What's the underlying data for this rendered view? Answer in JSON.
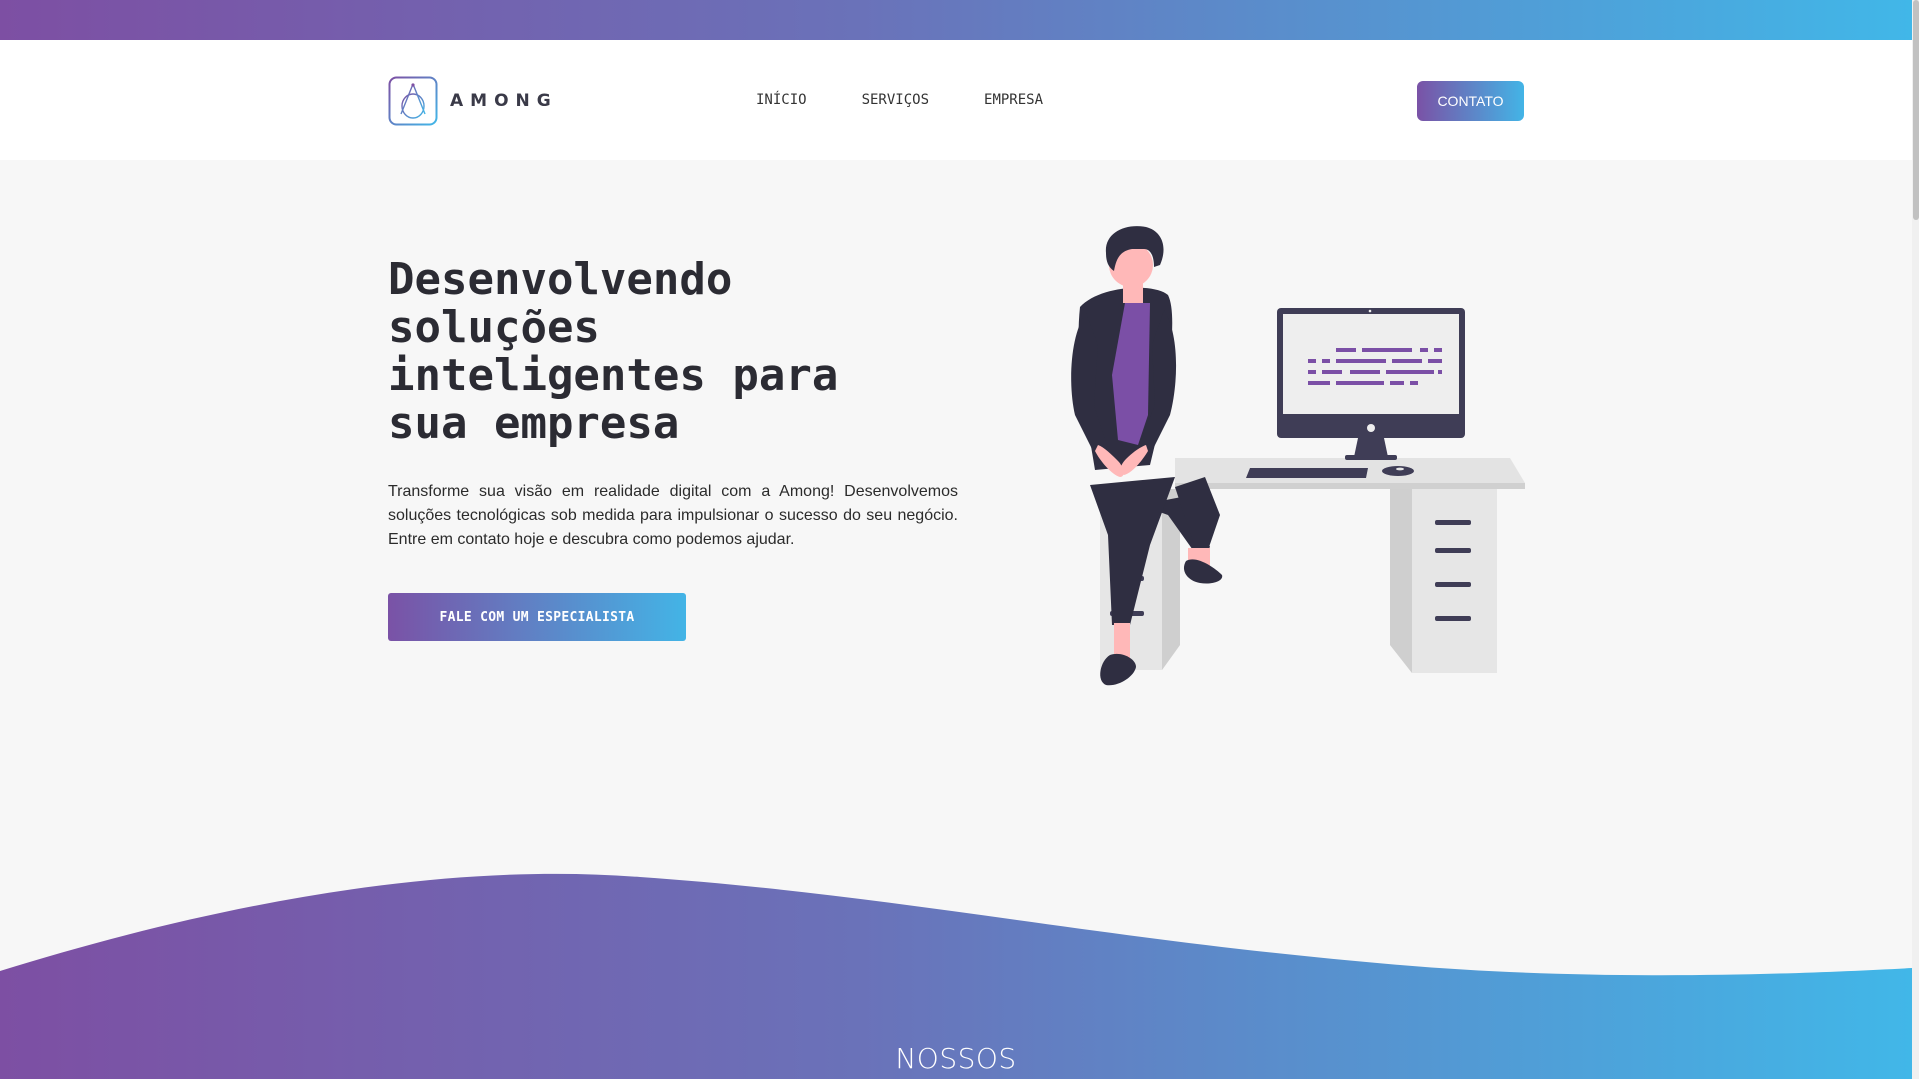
{
  "brand": {
    "name": "AMONG"
  },
  "nav": {
    "links": [
      "INÍCIO",
      "SERVIÇOS",
      "EMPRESA"
    ],
    "contact_label": "CONTATO"
  },
  "hero": {
    "title_lines": [
      "Desenvolvendo",
      "soluções",
      "inteligentes para",
      "sua empresa"
    ],
    "description": "Transforme sua visão em realidade digital com a Among! Desenvolvemos soluções tecnológicas sob medida para impulsionar o sucesso do seu negócio. Entre em contato hoje e descubra como podemos ajudar.",
    "cta_label": "FALE COM UM ESPECIALISTA"
  },
  "section": {
    "title": "NOSSOS"
  },
  "colors": {
    "gradient_start": "#7d4fa3",
    "gradient_end": "#41b7e8",
    "accent_purple": "#7b4fa6",
    "dark": "#2f2e41"
  }
}
